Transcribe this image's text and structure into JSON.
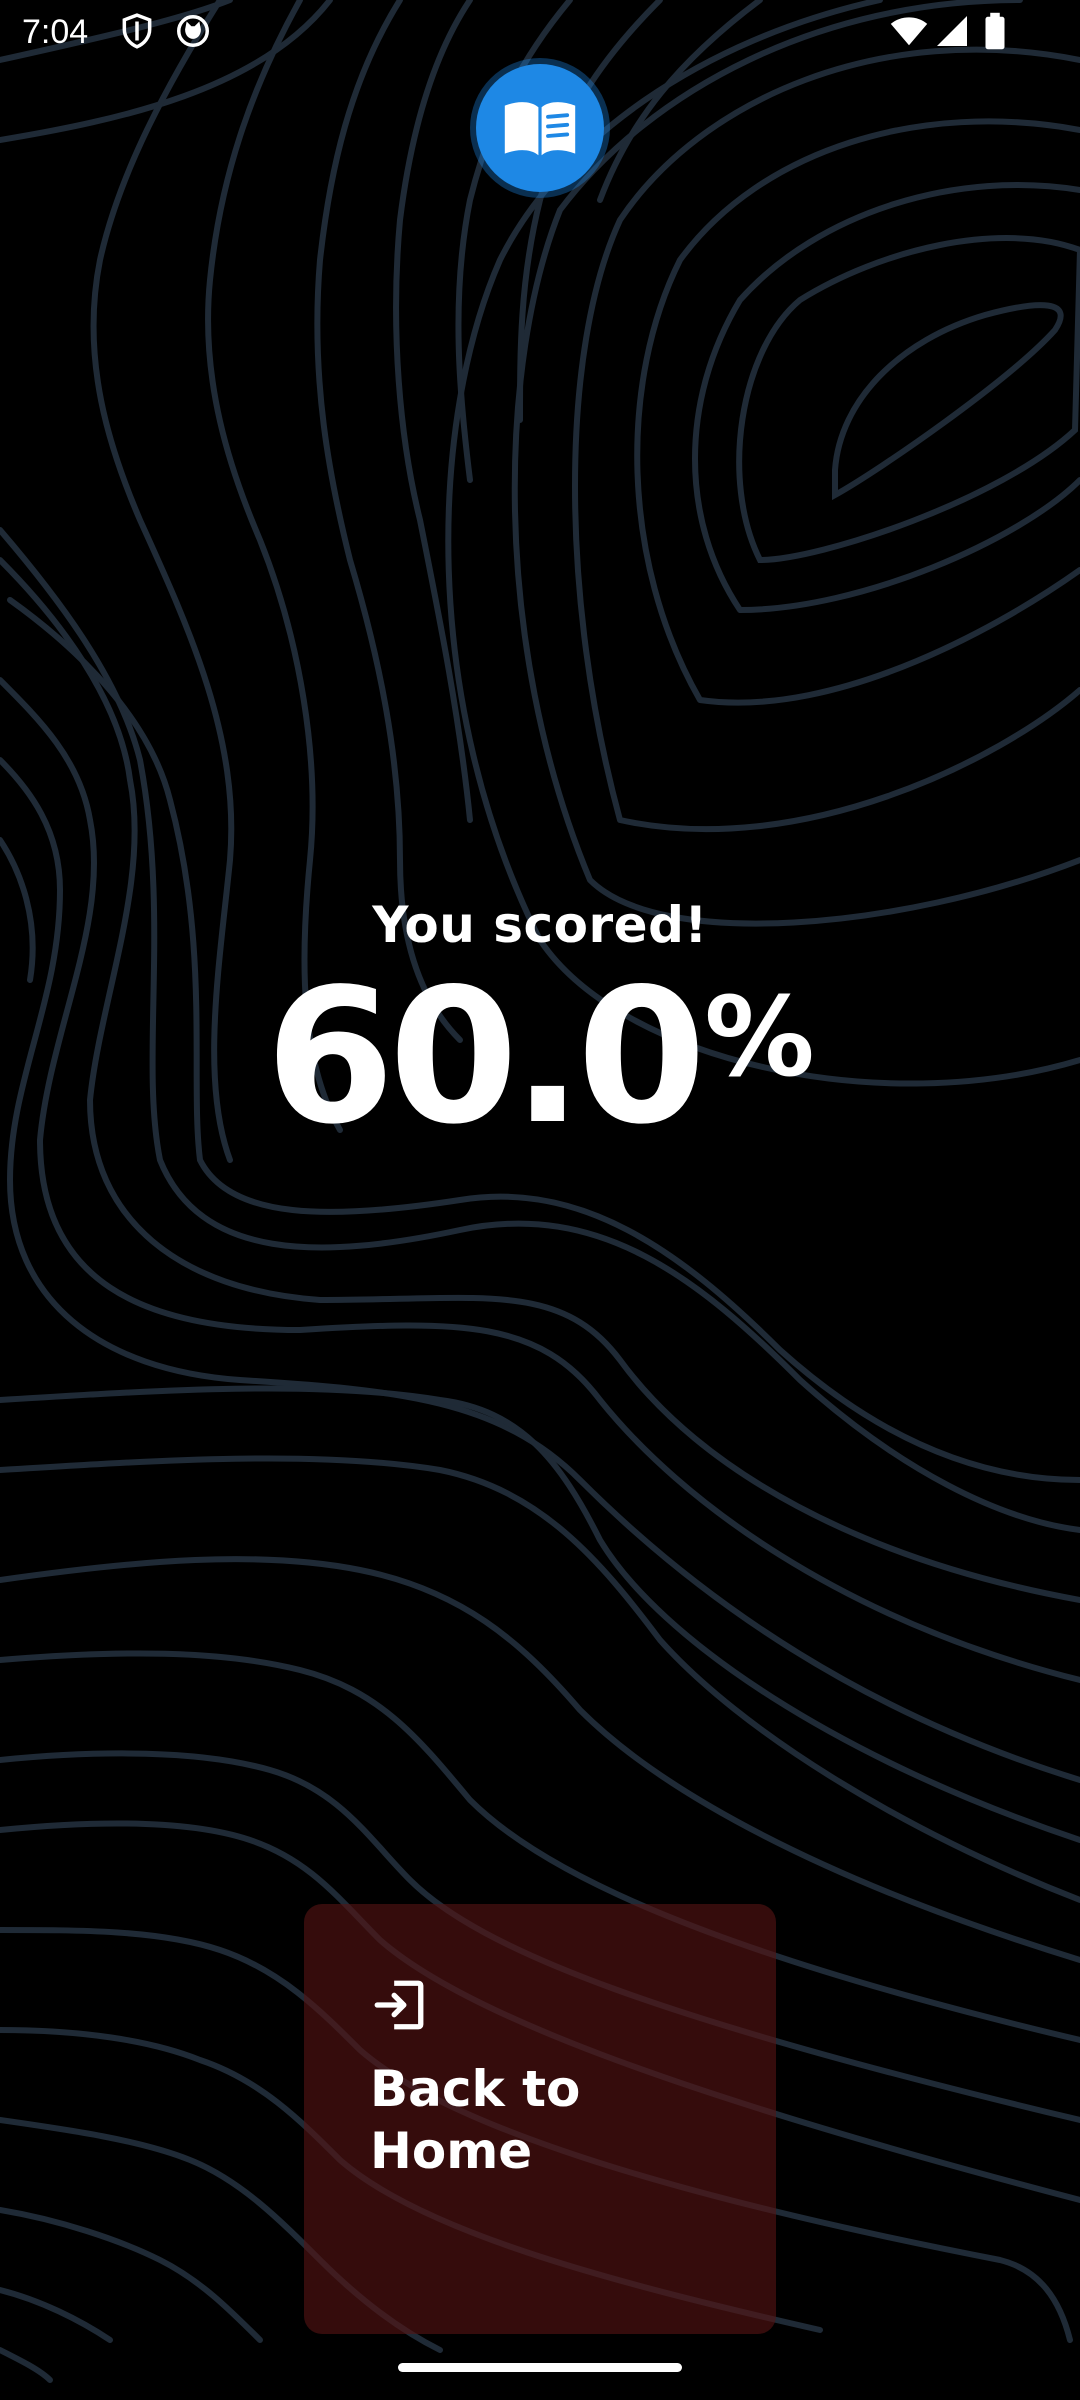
{
  "status_bar": {
    "time": "7:04",
    "left_icons": [
      "shield-icon",
      "cat-face-icon"
    ],
    "right_icons": [
      "wifi-icon",
      "cellular-signal-icon",
      "battery-icon"
    ]
  },
  "app": {
    "logo_icon": "open-book-icon",
    "accent_color": "#1e88e5"
  },
  "result": {
    "label": "You scored!",
    "score": "60.0",
    "unit": "%"
  },
  "home_button": {
    "icon": "exit-arrow-icon",
    "label": "Back to Home",
    "color": "#561414"
  },
  "colors": {
    "background": "#000000",
    "contour_lines": "#1f2a36"
  }
}
